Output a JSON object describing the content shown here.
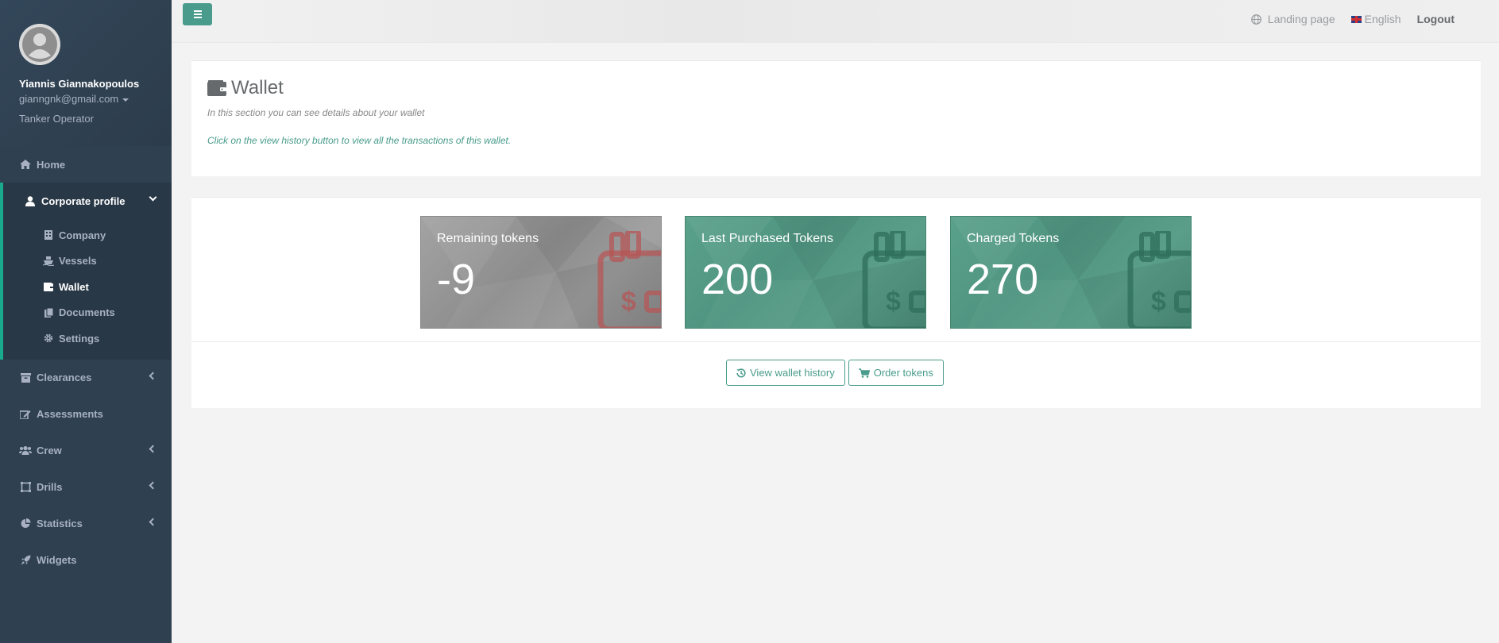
{
  "profile": {
    "name": "Yiannis Giannakopoulos",
    "email": "gianngnk@gmail.com",
    "role": "Tanker Operator"
  },
  "sidebar": {
    "items": [
      {
        "label": "Home",
        "icon": "home-icon"
      },
      {
        "label": "Corporate profile",
        "icon": "user-icon"
      },
      {
        "label": "Clearances",
        "icon": "archive-icon"
      },
      {
        "label": "Assessments",
        "icon": "edit-icon"
      },
      {
        "label": "Crew",
        "icon": "users-icon"
      },
      {
        "label": "Drills",
        "icon": "object-group-icon"
      },
      {
        "label": "Statistics",
        "icon": "pie-chart-icon"
      },
      {
        "label": "Widgets",
        "icon": "rocket-icon"
      }
    ],
    "subitems": [
      {
        "label": "Company",
        "icon": "building-icon"
      },
      {
        "label": "Vessels",
        "icon": "ship-icon"
      },
      {
        "label": "Wallet",
        "icon": "wallet-icon"
      },
      {
        "label": "Documents",
        "icon": "files-icon"
      },
      {
        "label": "Settings",
        "icon": "gear-icon"
      }
    ]
  },
  "topbar": {
    "landing": "Landing page",
    "language": "English",
    "logout": "Logout"
  },
  "header": {
    "title": "Wallet",
    "subtitle": "In this section you can see details about your wallet",
    "hint": "Click on the view history button to view all the transactions of this wallet."
  },
  "cards": [
    {
      "label": "Remaining tokens",
      "value": "-9"
    },
    {
      "label": "Last Purchased Tokens",
      "value": "200"
    },
    {
      "label": "Charged Tokens",
      "value": "270"
    }
  ],
  "actions": {
    "history": "View wallet history",
    "order": "Order tokens"
  },
  "colors": {
    "sidebar": "#2f4050",
    "accent": "#499c8b",
    "active_border": "#19aa8d",
    "card_gray": "#999999",
    "card_green": "#55998a",
    "warning_icon": "#c0504d"
  }
}
